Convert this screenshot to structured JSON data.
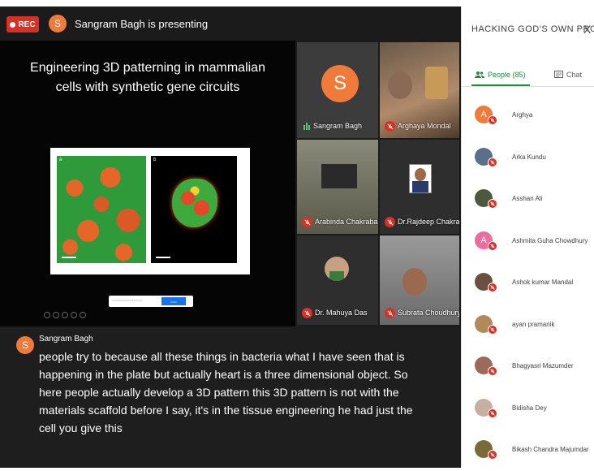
{
  "topbar": {
    "rec_label": "REC",
    "presenter_initial": "S",
    "presenting_text": "Sangram Bagh is presenting"
  },
  "slide": {
    "title_line1": "Engineering 3D patterning in mammalian",
    "title_line2": "cells with synthetic gene circuits",
    "panel_a_label": "a",
    "panel_b_label": "b"
  },
  "tiles": [
    {
      "name": "Sangram Bagh",
      "initial": "S",
      "speaking": true
    },
    {
      "name": "Arghaya Mondal"
    },
    {
      "name": "Arabinda Chakrabarti"
    },
    {
      "name": "Dr.Rajdeep Chakravarty"
    },
    {
      "name": "Dr. Mahuya Das"
    },
    {
      "name": "Subrata Choudhury"
    }
  ],
  "caption": {
    "initial": "S",
    "speaker": "Sangram Bagh",
    "text": "people try to because all these things in bacteria what I have seen that is happening in the plate but actually heart is a three dimensional object. So here people actually develop a 3D pattern this 3D pattern is not with the materials scaffold before I say, it's in the tissue engineering he had just the cell you give this"
  },
  "panel": {
    "title": "HACKING GOD'S OWN PRO...",
    "close": "X",
    "tab_people": "People (85)",
    "tab_chat": "Chat"
  },
  "people": [
    {
      "name": "Arghya",
      "initial": "A",
      "color": "#f07a3a"
    },
    {
      "name": "Arka Kundu",
      "initial": "",
      "color": "#5a6f8a"
    },
    {
      "name": "Asshan Ali",
      "initial": "",
      "color": "#4a5a3a"
    },
    {
      "name": "Ashmita Guha Chowdhury",
      "initial": "A",
      "color": "#ee6ba0"
    },
    {
      "name": "Ashok kumar Mandal",
      "initial": "",
      "color": "#6a5040"
    },
    {
      "name": "ayan pramanik",
      "initial": "",
      "color": "#b08a5a"
    },
    {
      "name": "Bhagyasri Mazumder",
      "initial": "",
      "color": "#9a6a5a"
    },
    {
      "name": "Bidisha Dey",
      "initial": "",
      "color": "#c8b0a0"
    },
    {
      "name": "Bikash Chandra Majumdar",
      "initial": "",
      "color": "#7a6a3a"
    }
  ],
  "colors": {
    "accent_green": "#1e8e3e",
    "mute_red": "#d93025",
    "avatar_orange": "#f07a3a"
  }
}
